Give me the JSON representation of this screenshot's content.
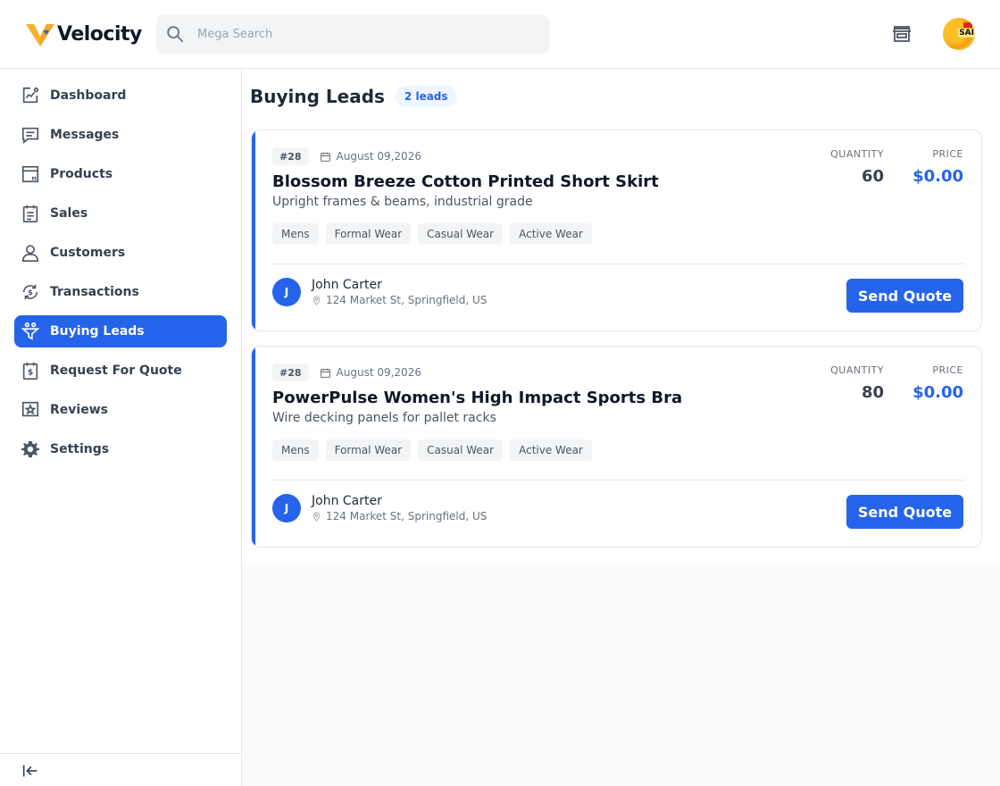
{
  "app": {
    "name": "Velocity"
  },
  "header": {
    "search_placeholder": "Mega Search",
    "avatar_label": "SAI",
    "icons": {
      "search": "search-icon",
      "store": "store-icon"
    }
  },
  "sidebar": {
    "items": [
      {
        "label": "Dashboard",
        "icon": "chart-icon"
      },
      {
        "label": "Messages",
        "icon": "message-icon"
      },
      {
        "label": "Products",
        "icon": "box-icon"
      },
      {
        "label": "Sales",
        "icon": "clipboard-icon"
      },
      {
        "label": "Customers",
        "icon": "user-icon"
      },
      {
        "label": "Transactions",
        "icon": "exchange-icon"
      },
      {
        "label": "Buying Leads",
        "icon": "funnel-icon",
        "active": true
      },
      {
        "label": "Request For Quote",
        "icon": "quote-icon"
      },
      {
        "label": "Reviews",
        "icon": "star-icon"
      },
      {
        "label": "Settings",
        "icon": "gear-icon"
      }
    ],
    "collapse_icon": "collapse-icon"
  },
  "main": {
    "title": "Buying Leads",
    "count_badge": "2 leads",
    "quantity_label": "QUANTITY",
    "price_label": "PRICE",
    "quote_button": "Send Quote",
    "leads": [
      {
        "id": "#28",
        "date": "August 09,2026",
        "title": "Blossom Breeze Cotton Printed Short Skirt",
        "description": "Upright frames & beams, industrial grade",
        "tags": [
          "Mens",
          "Formal Wear",
          "Casual Wear",
          "Active Wear"
        ],
        "quantity": "60",
        "price": "$0.00",
        "buyer": {
          "initial": "J",
          "name": "John Carter",
          "address": "124 Market St, Springfield, US"
        }
      },
      {
        "id": "#28",
        "date": "August 09,2026",
        "title": "PowerPulse Women's High Impact Sports Bra",
        "description": "Wire decking panels for pallet racks",
        "tags": [
          "Mens",
          "Formal Wear",
          "Casual Wear",
          "Active Wear"
        ],
        "quantity": "80",
        "price": "$0.00",
        "buyer": {
          "initial": "J",
          "name": "John Carter",
          "address": "124 Market St, Springfield, US"
        }
      }
    ]
  },
  "colors": {
    "accent": "#2563eb",
    "brand_logo": "#f5a623"
  }
}
